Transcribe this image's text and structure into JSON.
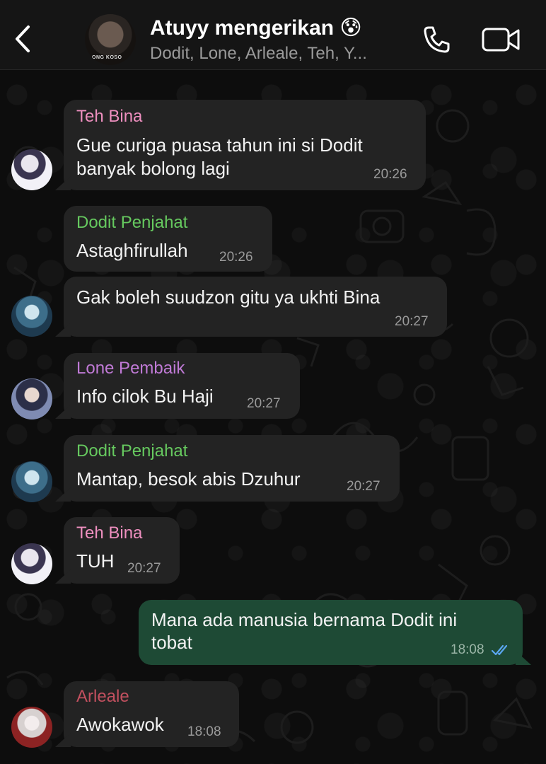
{
  "header": {
    "title": "Atuyy mengerikan 😰",
    "members": "Dodit, Lone, Arleale, Teh, Y...",
    "avatar_text": "ONG KOSO"
  },
  "icons": {
    "back": "chevron-left-icon",
    "call": "phone-icon",
    "video": "video-camera-icon",
    "read": "double-check-icon"
  },
  "colors": {
    "teh_bina": "#ee8fbf",
    "dodit": "#66c95f",
    "lone": "#c07ad6",
    "arleale": "#c2505f",
    "incoming_bubble": "#232323",
    "outgoing_bubble": "#1e4a35",
    "read_tick": "#5aa6f0"
  },
  "messages": [
    {
      "sender": "Teh Bina",
      "lines": [
        "Gue curiga puasa tahun ini si Dodit",
        "banyak bolong lagi"
      ],
      "time": "20:26"
    },
    {
      "sender": "Dodit Penjahat",
      "lines": [
        "Astaghfirullah"
      ],
      "time": "20:26"
    },
    {
      "sender": "",
      "lines": [
        "Gak boleh suudzon gitu ya ukhti Bina"
      ],
      "time": "20:27"
    },
    {
      "sender": "Lone Pembaik",
      "lines": [
        "Info cilok Bu Haji"
      ],
      "time": "20:27"
    },
    {
      "sender": "Dodit Penjahat",
      "lines": [
        "Mantap, besok abis Dzuhur"
      ],
      "time": "20:27"
    },
    {
      "sender": "Teh Bina",
      "lines": [
        "TUH"
      ],
      "time": "20:27"
    },
    {
      "sender": "",
      "lines": [
        "Mana ada manusia bernama Dodit ini",
        "tobat"
      ],
      "time": "18:08",
      "outgoing": true
    },
    {
      "sender": "Arleale",
      "lines": [
        "Awokawok"
      ],
      "time": "18:08"
    }
  ]
}
